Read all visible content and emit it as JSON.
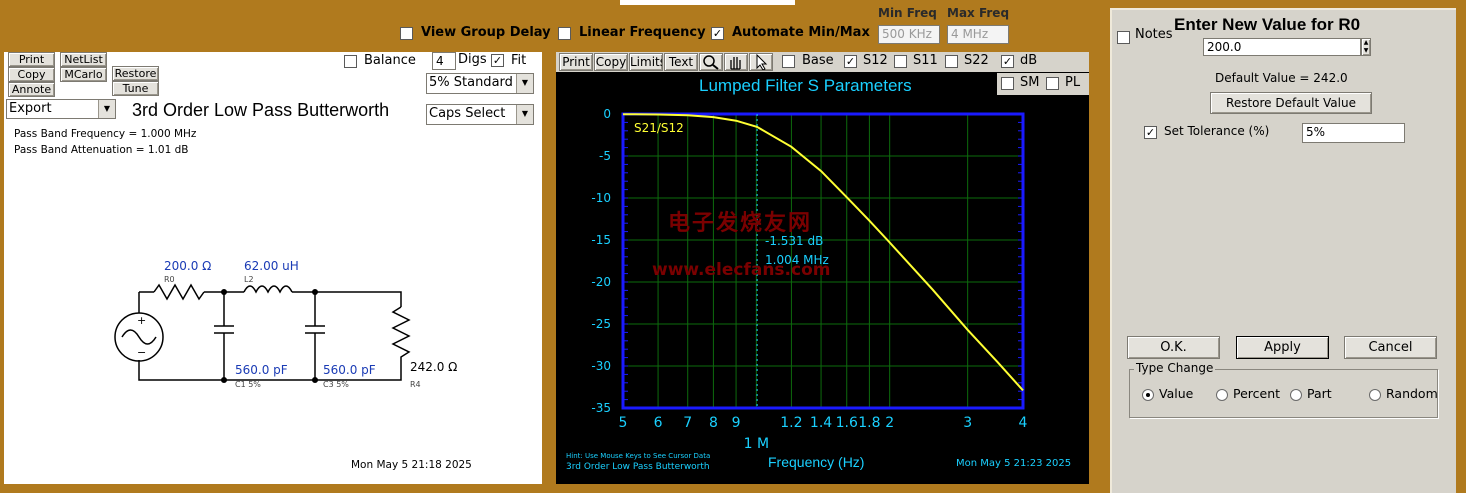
{
  "top_controls": {
    "view_group_delay": {
      "label": "View Group Delay",
      "checked": false
    },
    "linear_frequency": {
      "label": "Linear Frequency",
      "checked": false
    },
    "automate_min_max": {
      "label": "Automate Min/Max",
      "checked": true
    },
    "min_freq_label": "Min Freq",
    "max_freq_label": "Max Freq",
    "min_freq_value": "500 KHz",
    "max_freq_value": "4 MHz"
  },
  "left_panel": {
    "buttons": {
      "print": "Print",
      "netlist": "NetList",
      "copy": "Copy",
      "mcarlo": "MCarlo",
      "restore": "Restore",
      "annote": "Annote",
      "tune": "Tune"
    },
    "balance_label": "Balance",
    "digs_value": "4",
    "digs_label": "Digs",
    "fit_label": "Fit",
    "standard_select": "5% Standard",
    "export_select": "Export",
    "caps_select": "Caps Select",
    "title": "3rd Order Low Pass Butterworth",
    "info_line1": "Pass Band Frequency = 1.000 MHz",
    "info_line2": "Pass Band Attenuation = 1.01 dB",
    "components": {
      "r0_value": "200.0 Ω",
      "r0_name": "R0",
      "l2_value": "62.00 uH",
      "l2_name": "L2",
      "c1_value": "560.0 pF",
      "c1_name": "C1  5%",
      "c3_value": "560.0 pF",
      "c3_name": "C3  5%",
      "r4_value": "242.0 Ω",
      "r4_name": "R4"
    },
    "timestamp": "Mon May  5 21:18 2025"
  },
  "plot_panel": {
    "toolbar": {
      "print": "Print",
      "copy": "Copy",
      "limits": "Limits",
      "text": "Text"
    },
    "checks": {
      "base": "Base",
      "s12": "S12",
      "s11": "S11",
      "s22": "S22",
      "db": "dB",
      "sm": "SM",
      "pl": "PL"
    },
    "title": "Lumped Filter S Parameters",
    "trace_label": "S21/S12",
    "cursor_db": "-1.531 dB",
    "cursor_freq": "1.004 MHz",
    "watermark_line1": "电子发烧友网",
    "watermark_line2": "www.elecfans.com",
    "y_ticks": [
      "0",
      "-5",
      "-10",
      "-15",
      "-20",
      "-25",
      "-30",
      "-35"
    ],
    "x_ticks": [
      "5",
      "6",
      "7",
      "8",
      "9",
      "1.2",
      "1.4",
      "1.6",
      "1.8",
      "2",
      "3",
      "4"
    ],
    "x_decade_label": "1 M",
    "xlabel": "Frequency (Hz)",
    "hint": "Hint: Use Mouse Keys to See Cursor Data",
    "footer_title": "3rd Order Low Pass Butterworth",
    "timestamp": "Mon May  5 21:23 2025",
    "colors": {
      "trace": "#ffff33",
      "frame": "#1a1aff",
      "grid": "#0d6b0d",
      "text": "#1ad0ff"
    }
  },
  "chart_data": {
    "type": "line",
    "title": "Lumped Filter S Parameters",
    "xlabel": "Frequency (Hz)",
    "ylabel": "",
    "xscale": "log",
    "xlim": [
      500000,
      4000000
    ],
    "ylim": [
      -35,
      0
    ],
    "grid": true,
    "series": [
      {
        "name": "S21/S12",
        "x": [
          500000,
          600000,
          700000,
          800000,
          900000,
          1004000,
          1200000,
          1400000,
          1600000,
          1800000,
          2000000,
          2500000,
          3000000,
          3500000,
          4000000
        ],
        "y": [
          -0.02,
          -0.06,
          -0.15,
          -0.37,
          -0.8,
          -1.531,
          -3.9,
          -6.8,
          -9.9,
          -12.7,
          -15.3,
          -20.9,
          -25.7,
          -29.5,
          -32.9
        ]
      }
    ]
  },
  "right_panel": {
    "notes_label": "Notes",
    "title": "Enter New Value for R0",
    "value": "200.0",
    "default_text": "Default Value = 242.0",
    "restore_default": "Restore Default Value",
    "set_tolerance_label": "Set Tolerance (%)",
    "tolerance_value": "5%",
    "ok": "O.K.",
    "apply": "Apply",
    "cancel": "Cancel",
    "type_change_label": "Type Change",
    "radio_value": "Value",
    "radio_percent": "Percent",
    "radio_part": "Part",
    "radio_random": "Random"
  }
}
